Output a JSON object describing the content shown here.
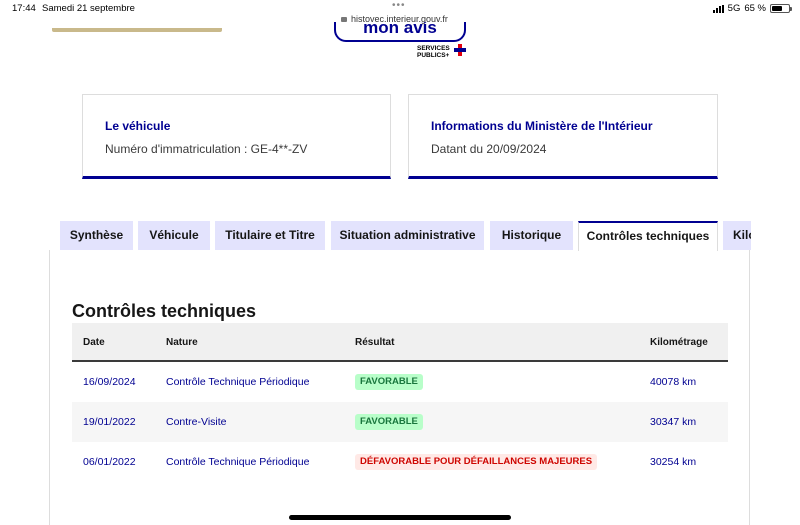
{
  "status_bar": {
    "time": "17:44",
    "date": "Samedi 21 septembre",
    "url": "histovec.interieur.gouv.fr",
    "network": "5G",
    "battery": "65 %",
    "battery_level": 0.65
  },
  "banner": {
    "mon_avis": "mon avis",
    "services_publics_line1": "SERVICES",
    "services_publics_line2": "PUBLICS+"
  },
  "cards": [
    {
      "title": "Le véhicule",
      "text": "Numéro d'immatriculation : GE-4**-ZV"
    },
    {
      "title": "Informations du Ministère de l'Intérieur",
      "text": "Datant du 20/09/2024"
    }
  ],
  "tabs": [
    {
      "label": "Synthèse"
    },
    {
      "label": "Véhicule"
    },
    {
      "label": "Titulaire et Titre"
    },
    {
      "label": "Situation administrative"
    },
    {
      "label": "Historique"
    },
    {
      "label": "Contrôles techniques"
    },
    {
      "label": "Kilométrage"
    }
  ],
  "active_tab": "Contrôles techniques",
  "section": {
    "title": "Contrôles techniques"
  },
  "table": {
    "headers": {
      "date": "Date",
      "nature": "Nature",
      "result": "Résultat",
      "km": "Kilométrage"
    },
    "rows": [
      {
        "date": "16/09/2024",
        "nature": "Contrôle Technique Périodique",
        "result": "FAVORABLE",
        "km": "40078 km"
      },
      {
        "date": "19/01/2022",
        "nature": "Contre-Visite",
        "result": "FAVORABLE",
        "km": "30347 km"
      },
      {
        "date": "06/01/2022",
        "nature": "Contrôle Technique Périodique",
        "result": "DÉFAVORABLE POUR DÉFAILLANCES MAJEURES",
        "km": "30254 km"
      }
    ]
  },
  "colors": {
    "primary": "#000091",
    "tab_bg": "#e3e3fd",
    "success_bg": "#b8fec9",
    "success_text": "#18753c",
    "error_bg": "#ffe9e6",
    "error_text": "#ce0500"
  }
}
